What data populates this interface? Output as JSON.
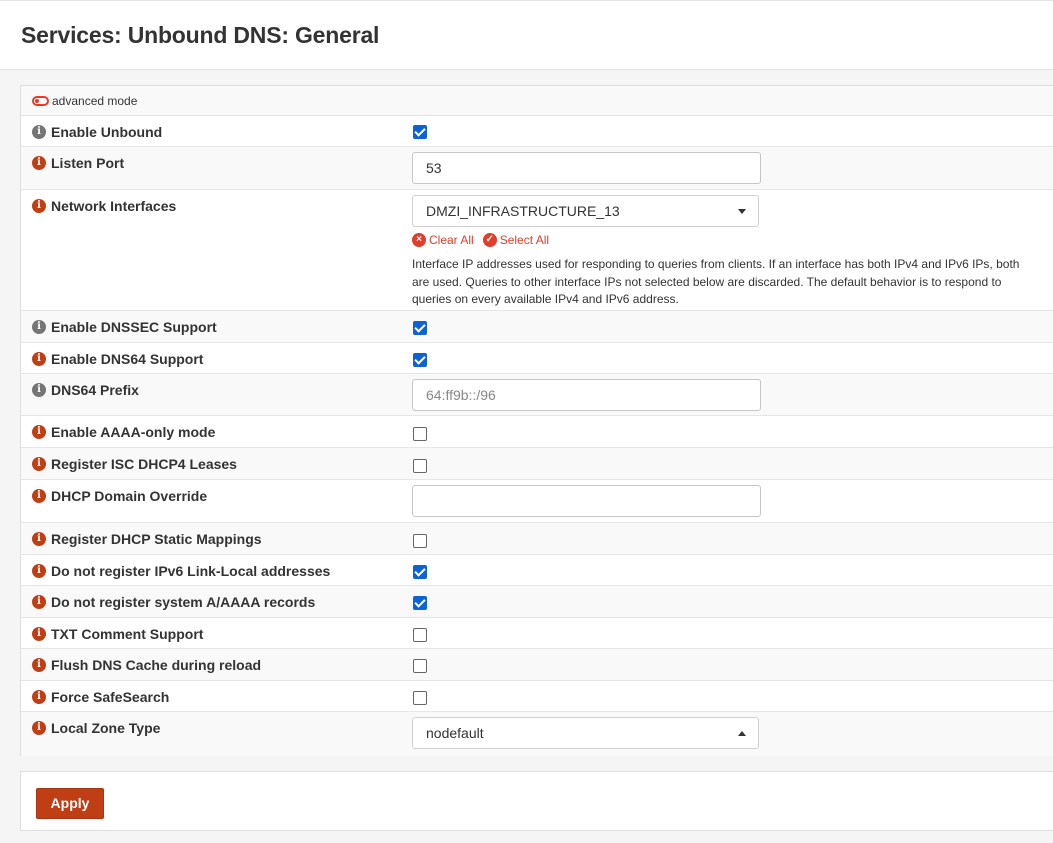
{
  "page": {
    "title": "Services: Unbound DNS: General"
  },
  "advanced_mode": {
    "label": "advanced mode"
  },
  "fields": {
    "enable_unbound": {
      "label": "Enable Unbound",
      "checked": true
    },
    "listen_port": {
      "label": "Listen Port",
      "value": "53"
    },
    "network_interfaces": {
      "label": "Network Interfaces",
      "selected": "DMZI_INFRASTRUCTURE_13",
      "clear_all": "Clear All",
      "select_all": "Select All",
      "help": "Interface IP addresses used for responding to queries from clients. If an interface has both IPv4 and IPv6 IPs, both are used. Queries to other interface IPs not selected below are discarded. The default behavior is to respond to queries on every available IPv4 and IPv6 address."
    },
    "enable_dnssec": {
      "label": "Enable DNSSEC Support",
      "checked": true
    },
    "enable_dns64": {
      "label": "Enable DNS64 Support",
      "checked": true
    },
    "dns64_prefix": {
      "label": "DNS64 Prefix",
      "placeholder": "64:ff9b::/96"
    },
    "aaaa_only": {
      "label": "Enable AAAA-only mode",
      "checked": false
    },
    "register_dhcp4": {
      "label": "Register ISC DHCP4 Leases",
      "checked": false
    },
    "dhcp_domain_override": {
      "label": "DHCP Domain Override",
      "value": ""
    },
    "register_static": {
      "label": "Register DHCP Static Mappings",
      "checked": false
    },
    "no_ipv6_linklocal": {
      "label": "Do not register IPv6 Link-Local addresses",
      "checked": true
    },
    "no_system_records": {
      "label": "Do not register system A/AAAA records",
      "checked": true
    },
    "txt_comment": {
      "label": "TXT Comment Support",
      "checked": false
    },
    "flush_cache": {
      "label": "Flush DNS Cache during reload",
      "checked": false
    },
    "safesearch": {
      "label": "Force SafeSearch",
      "checked": false
    },
    "local_zone_type": {
      "label": "Local Zone Type",
      "selected": "nodefault"
    }
  },
  "actions": {
    "apply": "Apply"
  },
  "colors": {
    "accent": "#c03e14",
    "checkbox": "#0b63d6",
    "link": "#e23d2a"
  }
}
